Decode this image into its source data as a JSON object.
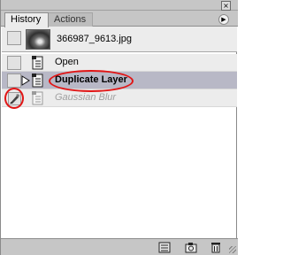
{
  "panel": {
    "tabs": [
      {
        "label": "History",
        "active": true
      },
      {
        "label": "Actions",
        "active": false
      }
    ],
    "menu_icon": "panel-menu-arrow-icon",
    "close_icon": "close-icon"
  },
  "snapshot": {
    "name": "366987_9613.jpg",
    "thumbnail_icon": "eye-photo-thumbnail"
  },
  "history_states": [
    {
      "label": "Open",
      "icon": "document-state-icon",
      "selected": false,
      "dimmed": false
    },
    {
      "label": "Duplicate Layer",
      "icon": "document-state-icon",
      "selected": true,
      "dimmed": false
    },
    {
      "label": "Gaussian Blur",
      "icon": "document-state-icon",
      "selected": false,
      "dimmed": true,
      "history_brush_source": true
    }
  ],
  "annotations": {
    "color": "#e11515",
    "targets": [
      "Duplicate Layer",
      "history-brush-source"
    ]
  },
  "toolbar": {
    "buttons": [
      "new-document-from-state-icon",
      "new-snapshot-icon",
      "delete-state-icon"
    ]
  },
  "colors": {
    "selected_row": "#b8b8c6",
    "panel_bg": "#ececec",
    "chrome": "#c6c6c6"
  }
}
